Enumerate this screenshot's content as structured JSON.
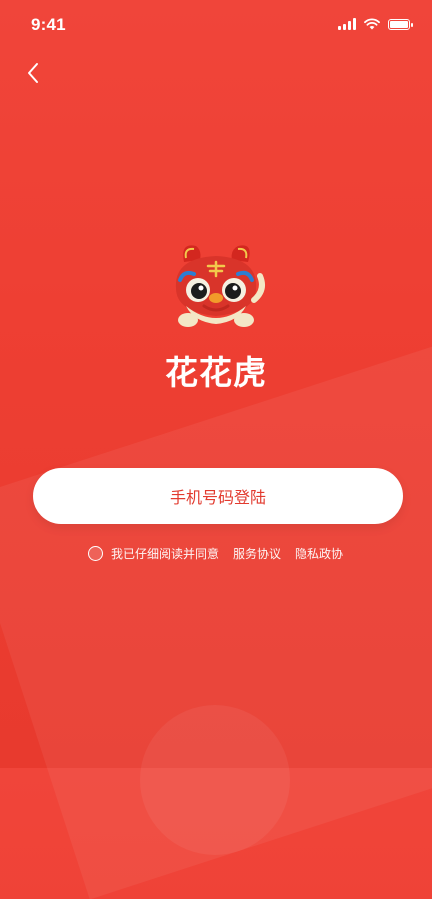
{
  "status_bar": {
    "time": "9:41"
  },
  "app": {
    "name": "花花虎"
  },
  "login": {
    "button_label": "手机号码登陆"
  },
  "agreement": {
    "text": "我已仔细阅读并同意",
    "service_link": "服务协议",
    "privacy_link": "隐私政协"
  },
  "icons": [
    "back-icon",
    "signal-icon",
    "wifi-icon",
    "battery-icon",
    "tiger-logo"
  ],
  "colors": {
    "background": "#ee3f33",
    "button_bg": "#ffffff",
    "button_text": "#e23a2e"
  }
}
